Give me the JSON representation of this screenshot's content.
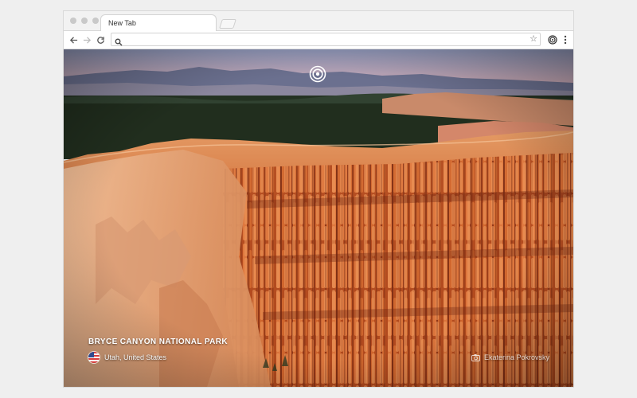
{
  "browser": {
    "tab": {
      "title": "New Tab"
    },
    "omnibox": {
      "value": "",
      "placeholder": ""
    },
    "icons": {
      "back": "back-arrow-icon",
      "forward": "forward-arrow-icon",
      "reload": "reload-icon",
      "search": "search-icon",
      "bookmark": "star-icon",
      "extension": "spiral-logo-icon",
      "menu": "more-vertical-icon"
    }
  },
  "page": {
    "logo": "spiral-logo-icon",
    "location": {
      "title": "BRYCE CANYON NATIONAL PARK",
      "place": "Utah, United States",
      "flag": "us-flag-icon"
    },
    "credit": {
      "icon": "camera-icon",
      "photographer": "Ekaterina Pokrovsky"
    }
  },
  "colors": {
    "sky_top": "#8e96b8",
    "sky_bottom": "#e9b2a9",
    "forest": "#233020",
    "rock_light": "#e9a06c",
    "rock_mid": "#c8602e",
    "rock_dark": "#7a2810"
  }
}
